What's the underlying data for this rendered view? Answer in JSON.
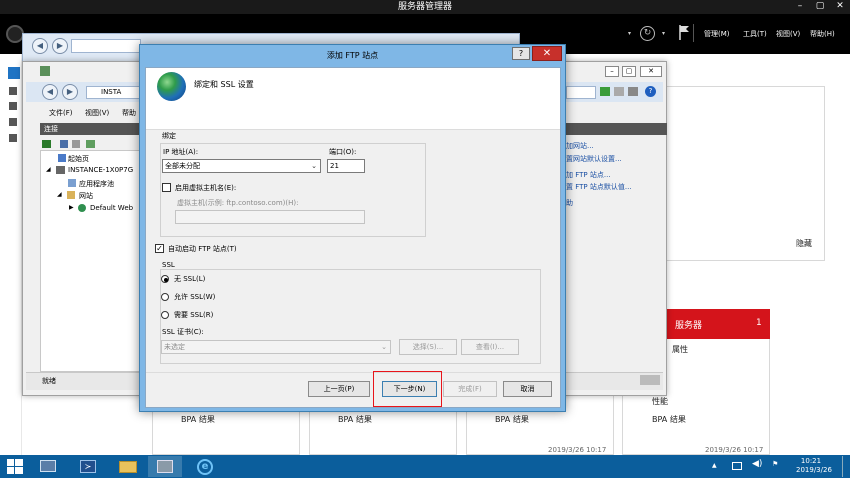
{
  "server_manager": {
    "title": "服务器管理器",
    "menu": [
      "管理(M)",
      "工具(T)",
      "视图(V)",
      "帮助(H)"
    ]
  },
  "background": {
    "panel_label": "服务器",
    "panel_count": "1",
    "attribute_label": "属性",
    "hide_label": "隐藏",
    "perf_label": "性能",
    "bpa_label": "BPA 结果",
    "timestamp": "2019/3/26 10:17",
    "actions": [
      "加网站...",
      "置网站默认设置...",
      "加 FTP 站点...",
      "置 FTP 站点默认值...",
      "助"
    ]
  },
  "iis": {
    "address": "INSTA",
    "menu": [
      "文件(F)",
      "视图(V)",
      "帮助"
    ],
    "connections_title": "连接",
    "tree": [
      "起始页",
      "INSTANCE-1X0P7G",
      "应用程序池",
      "网站",
      "Default Web"
    ],
    "status": "就绪"
  },
  "dialog": {
    "title": "添加 FTP 站点",
    "heading": "绑定和 SSL 设置",
    "binding_group": "绑定",
    "ip_label": "IP 地址(A):",
    "ip_value": "全部未分配",
    "port_label": "端口(O):",
    "port_value": "21",
    "virtual_host_check": "启用虚拟主机名(E):",
    "virtual_host_label": "虚拟主机(示例: ftp.contoso.com)(H):",
    "auto_start_check": "自动启动 FTP 站点(T)",
    "ssl_group": "SSL",
    "ssl_options": [
      "无 SSL(L)",
      "允许 SSL(W)",
      "需要 SSL(R)"
    ],
    "ssl_cert_label": "SSL 证书(C):",
    "ssl_cert_value": "未选定",
    "select_button": "选择(S)...",
    "view_button": "查看(I)...",
    "prev_button": "上一页(P)",
    "next_button": "下一步(N)",
    "finish_button": "完成(F)",
    "cancel_button": "取消",
    "help_glyph": "?",
    "close_glyph": "✕"
  },
  "tray": {
    "time": "10:21",
    "date": "2019/3/26"
  }
}
